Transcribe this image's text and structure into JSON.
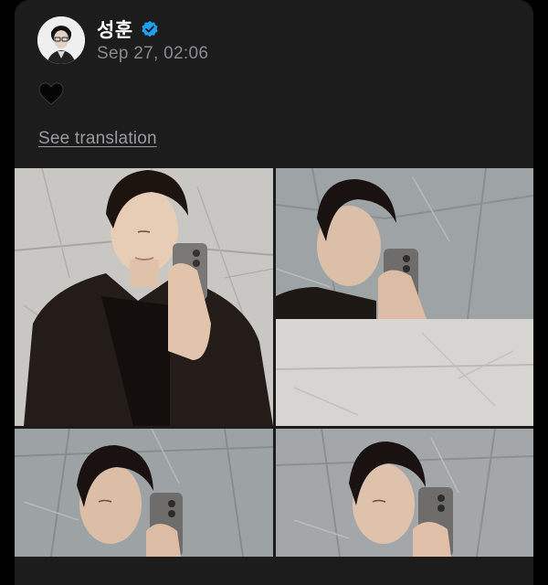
{
  "post": {
    "author": {
      "name": "성훈",
      "verified": true,
      "verified_color": "#1fa1f1"
    },
    "timestamp": "Sep 27, 02:06",
    "text_icon": "black-heart-icon",
    "translate_label": "See translation",
    "photos": [
      {
        "subject": "mirror-selfie-black-suit"
      },
      {
        "subject": "mirror-selfie-marble-wall"
      },
      {
        "subject": "mirror-selfie-marble-wall"
      },
      {
        "subject": "mirror-selfie-marble-wall"
      }
    ]
  },
  "colors": {
    "card_background": "#1c1c1d",
    "page_background": "#000000",
    "muted_text": "#8a8a8e"
  }
}
